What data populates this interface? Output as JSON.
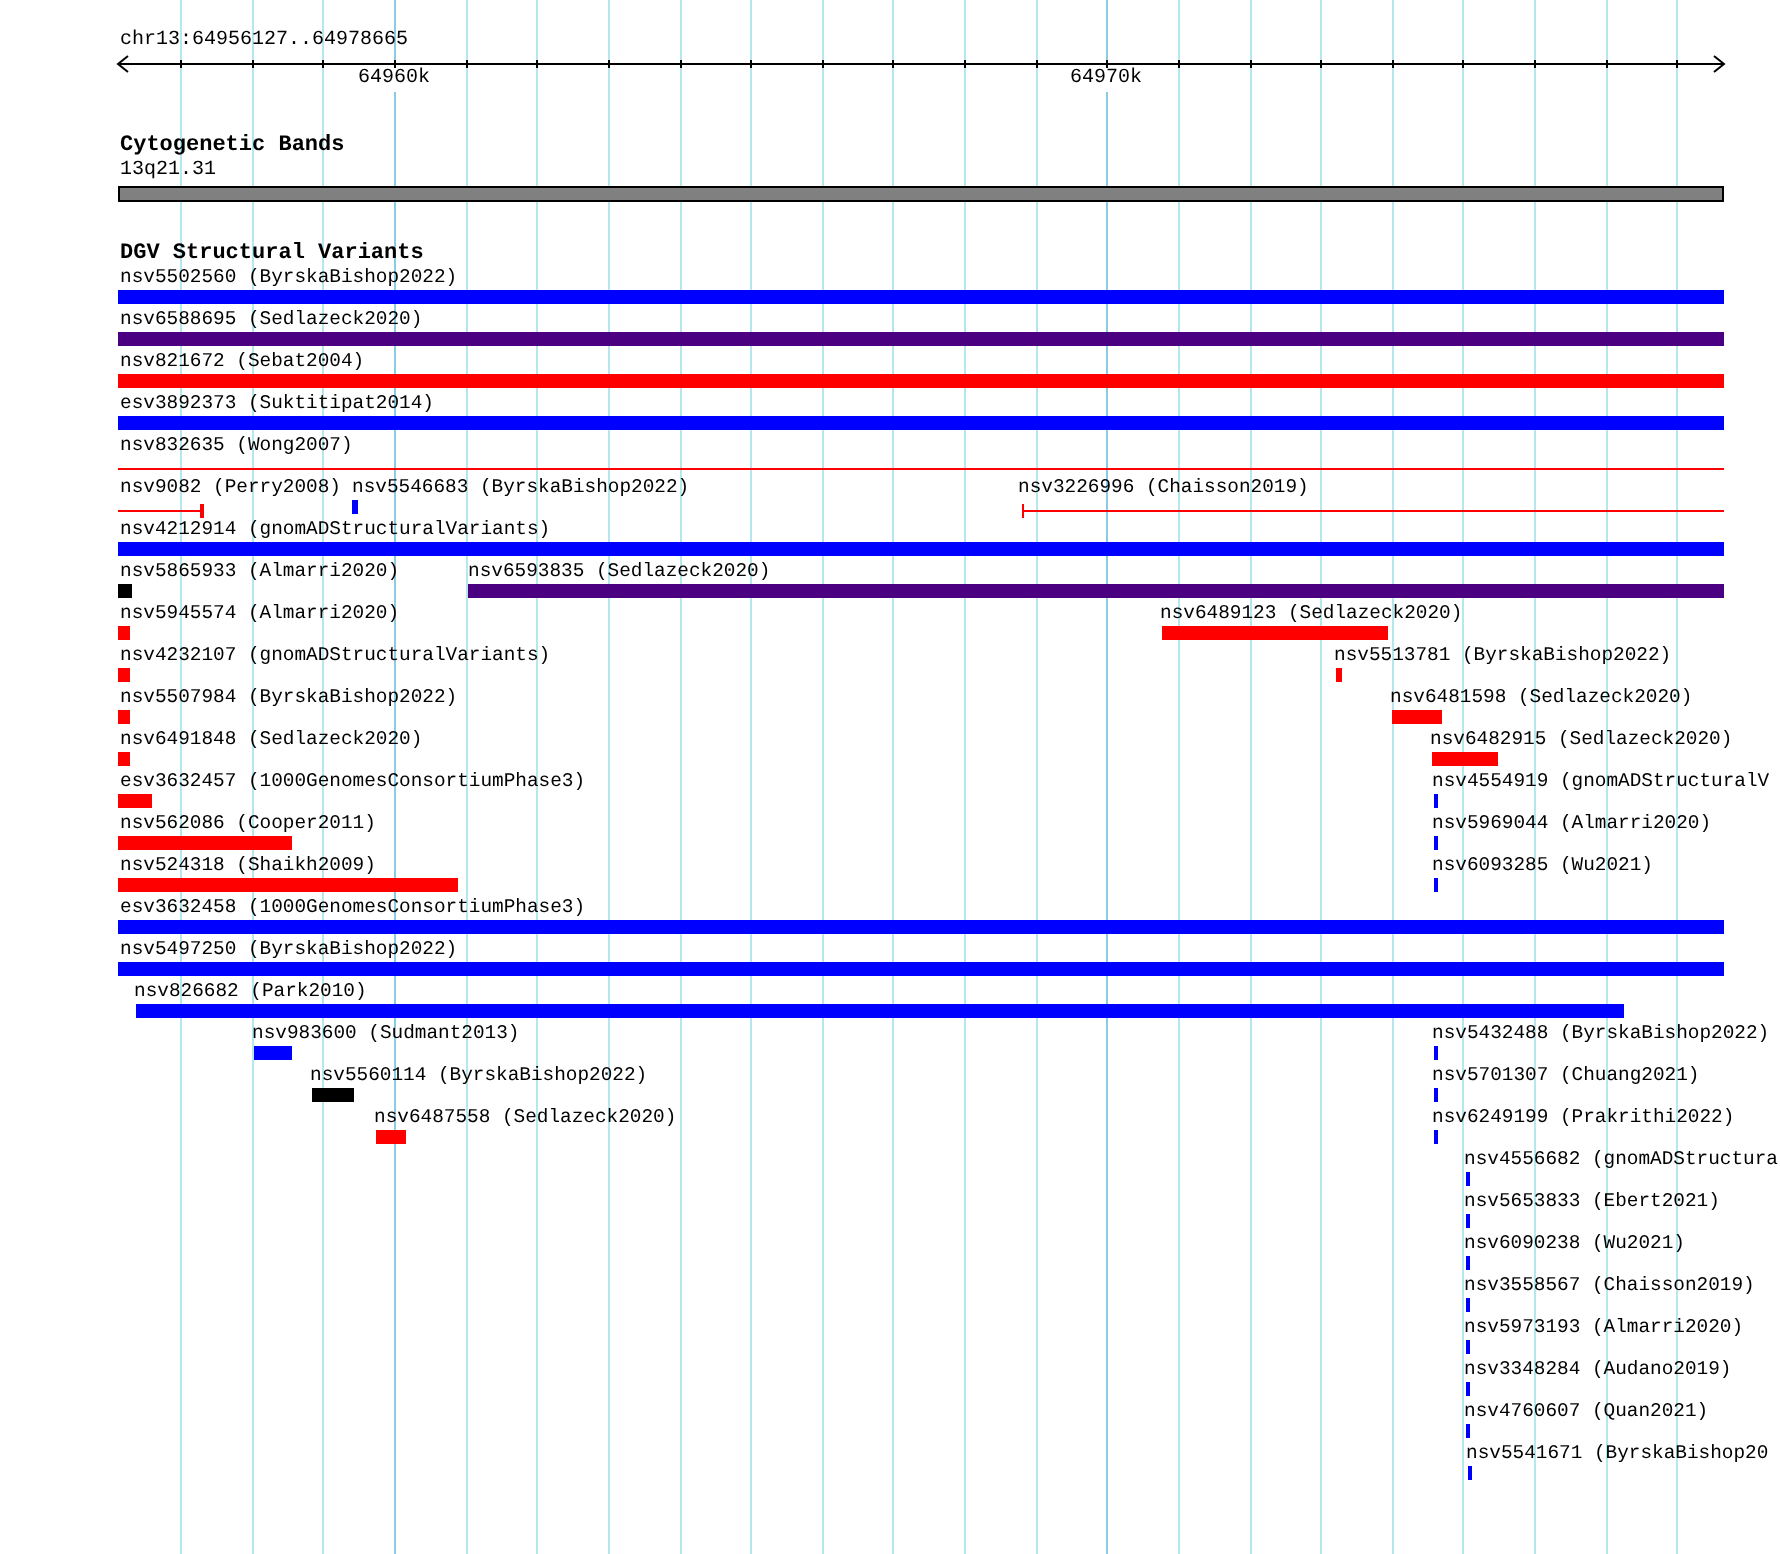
{
  "ruler": {
    "location": "chr13:64956127..64978665",
    "labels": [
      "64960k",
      "64970k"
    ]
  },
  "tracks": [
    {
      "title": "Cytogenetic Bands",
      "features": [
        {
          "label": "13q21.31",
          "kind": "band",
          "color": "#808080"
        }
      ]
    },
    {
      "title": "DGV Structural Variants",
      "features": [
        {
          "label": "nsv5502560 (ByrskaBishop2022)",
          "kind": "thick",
          "color": "#0000ff"
        },
        {
          "label": "nsv6588695 (Sedlazeck2020)",
          "kind": "thick",
          "color": "#4b0082"
        },
        {
          "label": "nsv821672 (Sebat2004)",
          "kind": "thick",
          "color": "#ff0000"
        },
        {
          "label": "esv3892373 (Suktitipat2014)",
          "kind": "thick",
          "color": "#0000ff"
        },
        {
          "label": "nsv832635 (Wong2007)",
          "kind": "thin",
          "color": "#ff0000"
        },
        {
          "label": "nsv9082 (Perry2008)",
          "kind": "thin",
          "color": "#ff0000"
        },
        {
          "label": "nsv5546683 (ByrskaBishop2022)",
          "kind": "thick",
          "color": "#0000ff"
        },
        {
          "label": "nsv3226996 (Chaisson2019)",
          "kind": "thin",
          "color": "#ff0000"
        },
        {
          "label": "nsv4212914 (gnomADStructuralVariants)",
          "kind": "thick",
          "color": "#0000ff"
        },
        {
          "label": "nsv5865933 (Almarri2020)",
          "kind": "thick",
          "color": "#000000"
        },
        {
          "label": "nsv6593835 (Sedlazeck2020)",
          "kind": "thick",
          "color": "#4b0082"
        },
        {
          "label": "nsv5945574 (Almarri2020)",
          "kind": "thick",
          "color": "#ff0000"
        },
        {
          "label": "nsv6489123 (Sedlazeck2020)",
          "kind": "thick",
          "color": "#ff0000"
        },
        {
          "label": "nsv4232107 (gnomADStructuralVariants)",
          "kind": "thick",
          "color": "#ff0000"
        },
        {
          "label": "nsv5513781 (ByrskaBishop2022)",
          "kind": "thick",
          "color": "#ff0000"
        },
        {
          "label": "nsv5507984 (ByrskaBishop2022)",
          "kind": "thick",
          "color": "#ff0000"
        },
        {
          "label": "nsv6481598 (Sedlazeck2020)",
          "kind": "thick",
          "color": "#ff0000"
        },
        {
          "label": "nsv6491848 (Sedlazeck2020)",
          "kind": "thick",
          "color": "#ff0000"
        },
        {
          "label": "nsv6482915 (Sedlazeck2020)",
          "kind": "thick",
          "color": "#ff0000"
        },
        {
          "label": "esv3632457 (1000GenomesConsortiumPhase3)",
          "kind": "thick",
          "color": "#ff0000"
        },
        {
          "label": "nsv4554919 (gnomADStructuralV",
          "kind": "thick",
          "color": "#0000ff"
        },
        {
          "label": "nsv562086 (Cooper2011)",
          "kind": "thick",
          "color": "#ff0000"
        },
        {
          "label": "nsv5969044 (Almarri2020)",
          "kind": "thick",
          "color": "#0000ff"
        },
        {
          "label": "nsv524318 (Shaikh2009)",
          "kind": "thick",
          "color": "#ff0000"
        },
        {
          "label": "nsv6093285 (Wu2021)",
          "kind": "thick",
          "color": "#0000ff"
        },
        {
          "label": "esv3632458 (1000GenomesConsortiumPhase3)",
          "kind": "thick",
          "color": "#0000ff"
        },
        {
          "label": "nsv5497250 (ByrskaBishop2022)",
          "kind": "thick",
          "color": "#0000ff"
        },
        {
          "label": "nsv826682 (Park2010)",
          "kind": "thick",
          "color": "#0000ff"
        },
        {
          "label": "nsv983600 (Sudmant2013)",
          "kind": "thick",
          "color": "#0000ff"
        },
        {
          "label": "nsv5432488 (ByrskaBishop2022)",
          "kind": "thick",
          "color": "#0000ff"
        },
        {
          "label": "nsv5560114 (ByrskaBishop2022)",
          "kind": "thick",
          "color": "#000000"
        },
        {
          "label": "nsv5701307 (Chuang2021)",
          "kind": "thick",
          "color": "#0000ff"
        },
        {
          "label": "nsv6487558 (Sedlazeck2020)",
          "kind": "thick",
          "color": "#ff0000"
        },
        {
          "label": "nsv6249199 (Prakrithi2022)",
          "kind": "thick",
          "color": "#0000ff"
        },
        {
          "label": "nsv4556682 (gnomADStructura",
          "kind": "thick",
          "color": "#0000ff"
        },
        {
          "label": "nsv5653833 (Ebert2021)",
          "kind": "thick",
          "color": "#0000ff"
        },
        {
          "label": "nsv6090238 (Wu2021)",
          "kind": "thick",
          "color": "#0000ff"
        },
        {
          "label": "nsv3558567 (Chaisson2019)",
          "kind": "thick",
          "color": "#0000ff"
        },
        {
          "label": "nsv5973193 (Almarri2020)",
          "kind": "thick",
          "color": "#0000ff"
        },
        {
          "label": "nsv3348284 (Audano2019)",
          "kind": "thick",
          "color": "#0000ff"
        },
        {
          "label": "nsv4760607 (Quan2021)",
          "kind": "thick",
          "color": "#0000ff"
        },
        {
          "label": "nsv5541671 (ByrskaBishop20",
          "kind": "thick",
          "color": "#0000ff"
        }
      ]
    }
  ]
}
